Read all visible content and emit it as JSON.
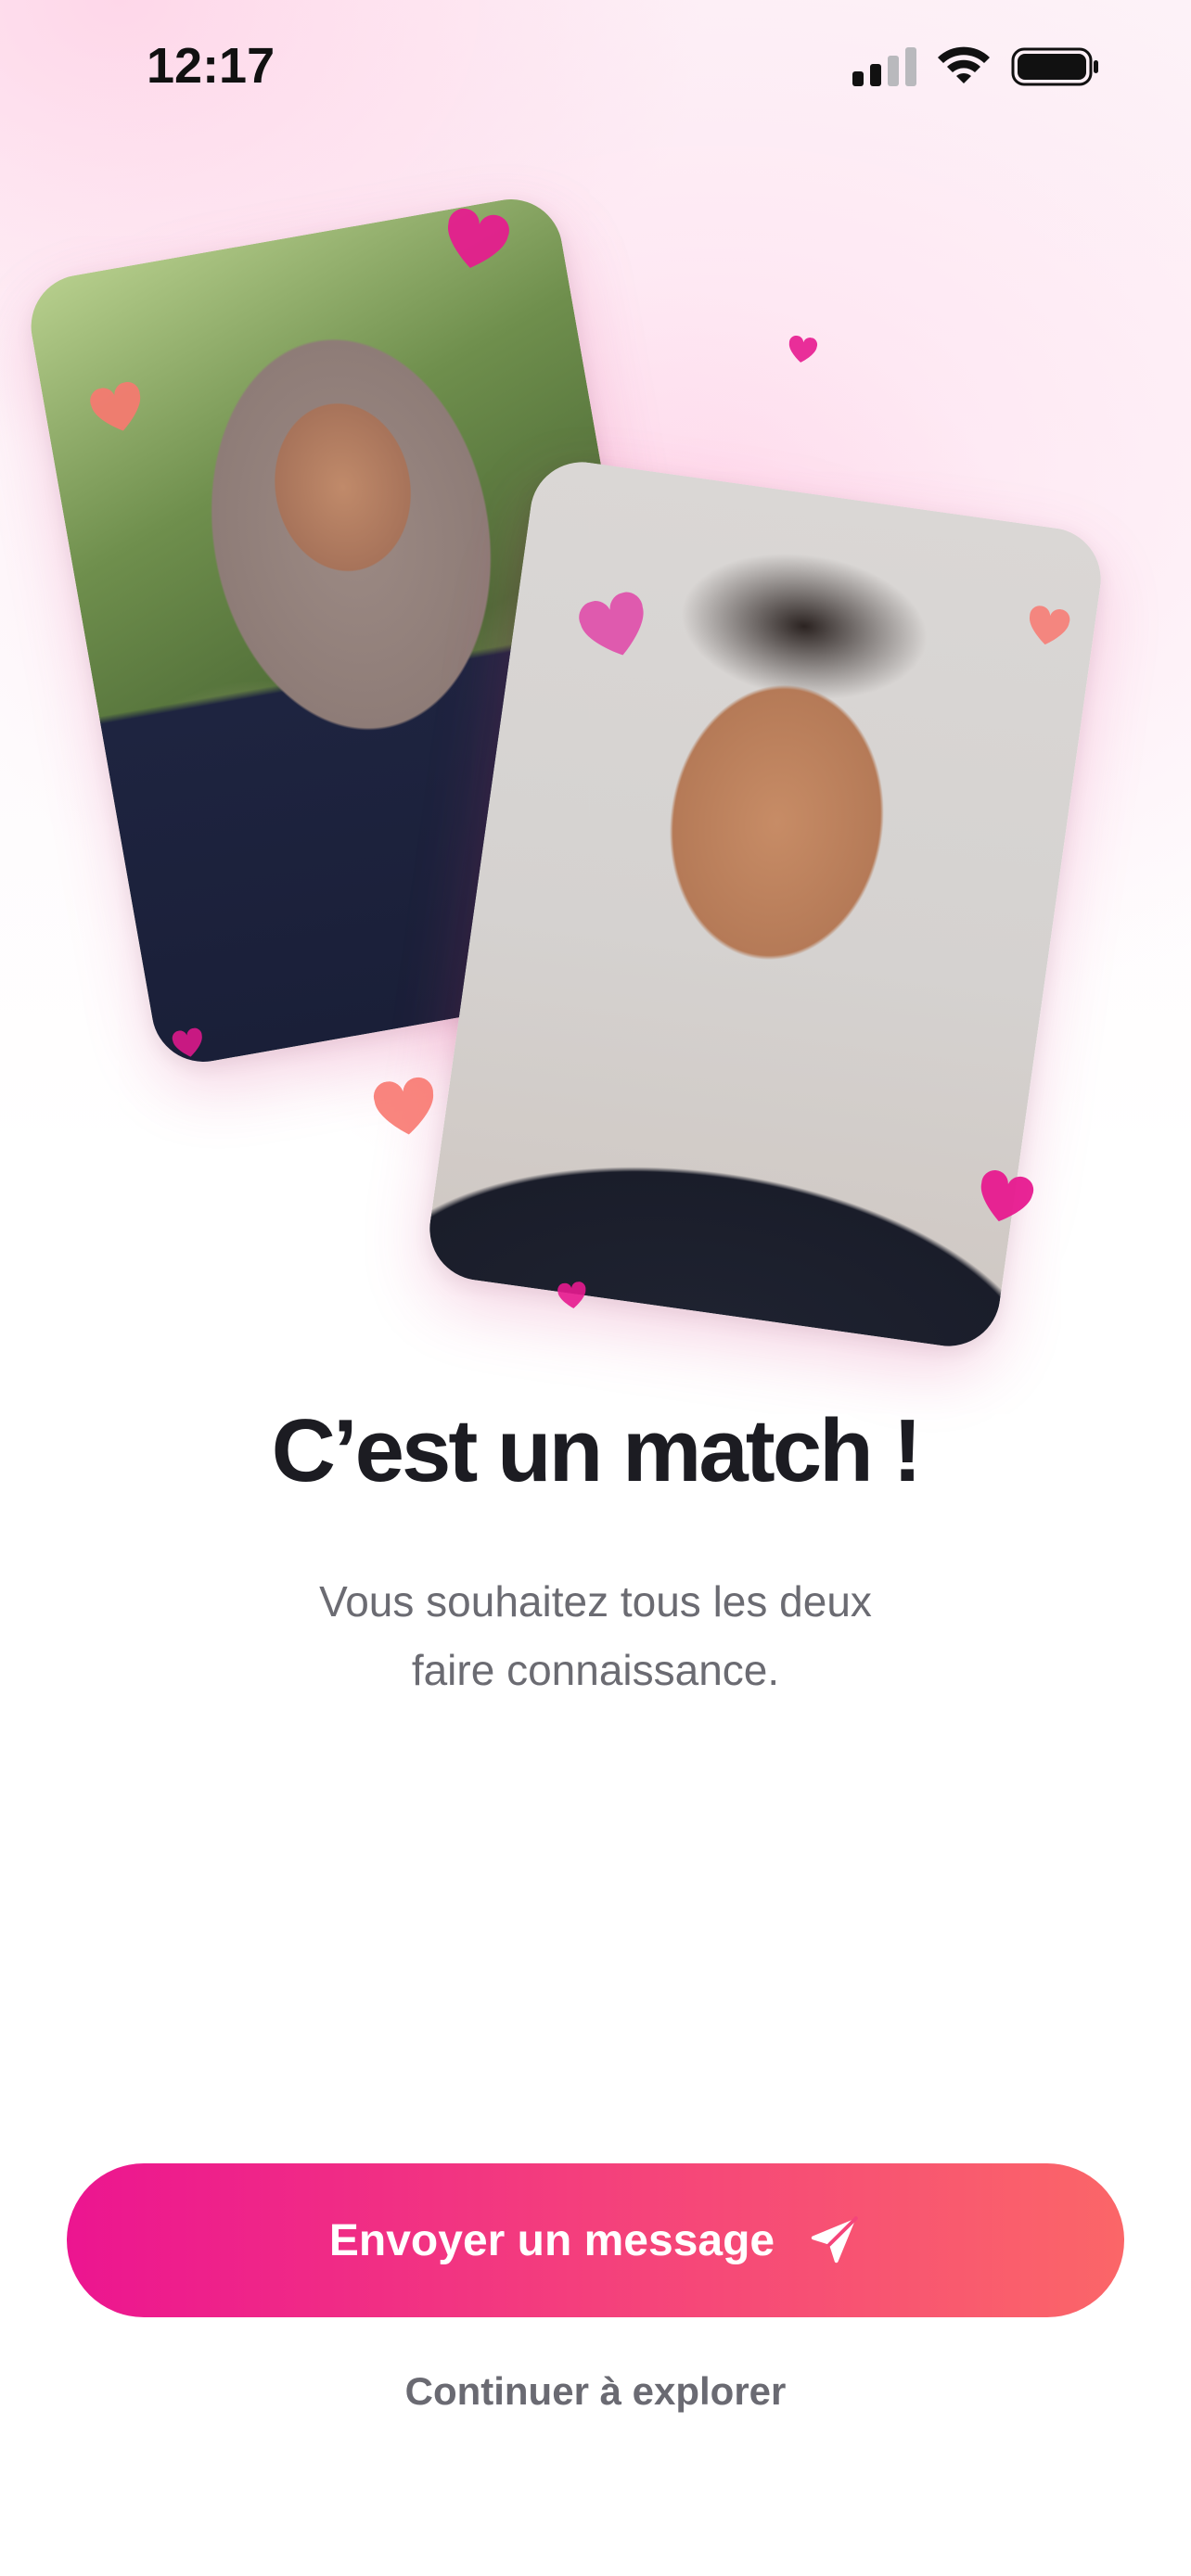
{
  "status_bar": {
    "time": "12:17",
    "signal_icon": "cellular-signal-icon",
    "wifi_icon": "wifi-icon",
    "battery_icon": "battery-icon"
  },
  "photos": {
    "left_photo": "woman-in-hijab-photo",
    "right_photo": "man-portrait-photo"
  },
  "match": {
    "title": "C’est un match !",
    "subtitle_line1": "Vous souhaitez tous les deux",
    "subtitle_line2": "faire connaissance."
  },
  "actions": {
    "send_message_label": "Envoyer un message",
    "send_icon": "paper-plane-icon",
    "continue_label": "Continuer à explorer"
  },
  "colors": {
    "heart_magenta": "#e7198f",
    "heart_coral": "#f87870",
    "button_gradient_start": "#ec1590",
    "button_gradient_end": "#fb6668",
    "title_color": "#1c1c22",
    "subtitle_color": "#6b6b72"
  }
}
